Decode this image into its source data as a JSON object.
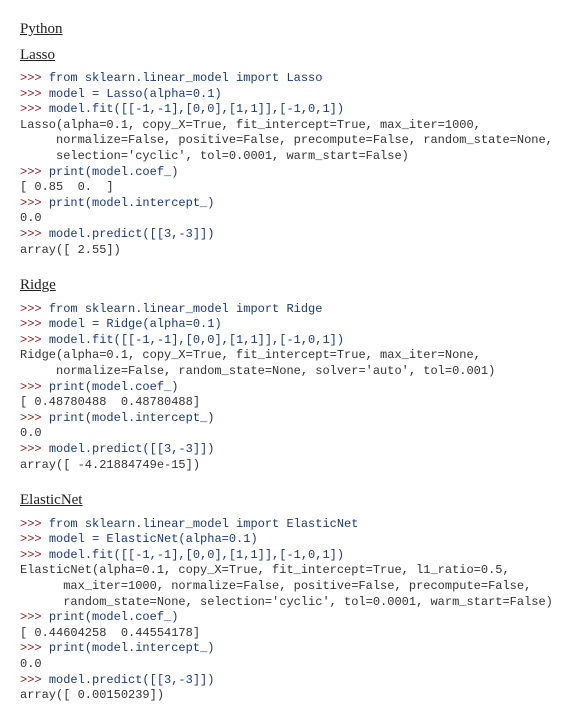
{
  "title_main": "Python",
  "sections": [
    {
      "title": "Lasso",
      "lines": [
        {
          "prompt": ">>> ",
          "input": "from sklearn.linear_model import Lasso"
        },
        {
          "prompt": ">>> ",
          "input": "model = Lasso(alpha=0.1)"
        },
        {
          "prompt": ">>> ",
          "input": "model.fit([[-1,-1],[0,0],[1,1]],[-1,0,1])"
        },
        {
          "output": "Lasso(alpha=0.1, copy_X=True, fit_intercept=True, max_iter=1000,"
        },
        {
          "output": "     normalize=False, positive=False, precompute=False, random_state=None,"
        },
        {
          "output": "     selection='cyclic', tol=0.0001, warm_start=False)"
        },
        {
          "prompt": ">>> ",
          "input": "print(model.coef_)"
        },
        {
          "output": "[ 0.85  0.  ]"
        },
        {
          "prompt": ">>> ",
          "input": "print(model.intercept_)"
        },
        {
          "output": "0.0"
        },
        {
          "prompt": ">>> ",
          "input": "model.predict([[3,-3]])"
        },
        {
          "output": "array([ 2.55])"
        }
      ]
    },
    {
      "title": "Ridge",
      "lines": [
        {
          "prompt": ">>> ",
          "input": "from sklearn.linear_model import Ridge"
        },
        {
          "prompt": ">>> ",
          "input": "model = Ridge(alpha=0.1)"
        },
        {
          "prompt": ">>> ",
          "input": "model.fit([[-1,-1],[0,0],[1,1]],[-1,0,1])"
        },
        {
          "output": "Ridge(alpha=0.1, copy_X=True, fit_intercept=True, max_iter=None,"
        },
        {
          "output": "     normalize=False, random_state=None, solver='auto', tol=0.001)"
        },
        {
          "prompt": ">>> ",
          "input": "print(model.coef_)"
        },
        {
          "output": "[ 0.48780488  0.48780488]"
        },
        {
          "prompt": ">>> ",
          "input": "print(model.intercept_)"
        },
        {
          "output": "0.0"
        },
        {
          "prompt": ">>> ",
          "input": "model.predict([[3,-3]])"
        },
        {
          "output": "array([ -4.21884749e-15])"
        }
      ]
    },
    {
      "title": "ElasticNet",
      "lines": [
        {
          "prompt": ">>> ",
          "input": "from sklearn.linear_model import ElasticNet"
        },
        {
          "prompt": ">>> ",
          "input": "model = ElasticNet(alpha=0.1)"
        },
        {
          "prompt": ">>> ",
          "input": "model.fit([[-1,-1],[0,0],[1,1]],[-1,0,1])"
        },
        {
          "output": "ElasticNet(alpha=0.1, copy_X=True, fit_intercept=True, l1_ratio=0.5,"
        },
        {
          "output": "      max_iter=1000, normalize=False, positive=False, precompute=False,"
        },
        {
          "output": "      random_state=None, selection='cyclic', tol=0.0001, warm_start=False)"
        },
        {
          "prompt": ">>> ",
          "input": "print(model.coef_)"
        },
        {
          "output": "[ 0.44604258  0.44554178]"
        },
        {
          "prompt": ">>> ",
          "input": "print(model.intercept_)"
        },
        {
          "output": "0.0"
        },
        {
          "prompt": ">>> ",
          "input": "model.predict([[3,-3]])"
        },
        {
          "output": "array([ 0.00150239])"
        }
      ]
    }
  ]
}
